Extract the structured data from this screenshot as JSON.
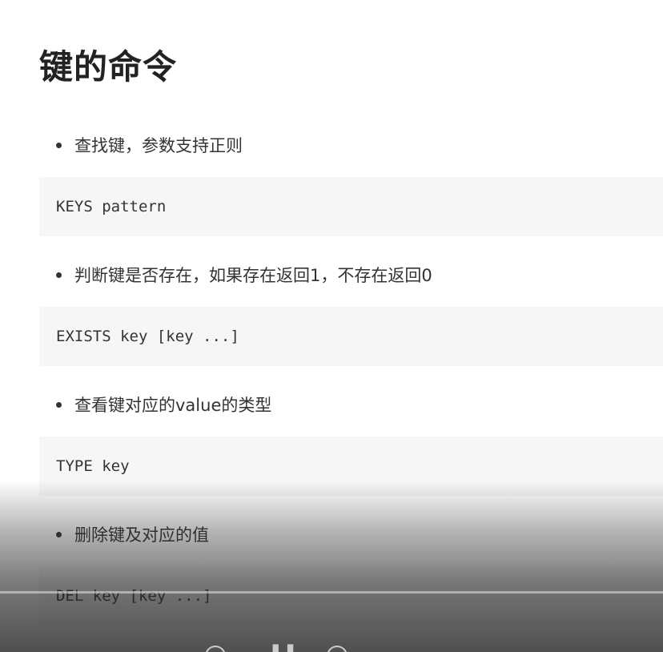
{
  "heading": "键的命令",
  "sections": [
    {
      "bullet": "查找键，参数支持正则",
      "code": "KEYS pattern"
    },
    {
      "bullet": "判断键是否存在，如果存在返回1，不存在返回0",
      "code": "EXISTS key [key ...]"
    },
    {
      "bullet": "查看键对应的value的类型",
      "code": "TYPE key"
    },
    {
      "bullet": "删除键及对应的值",
      "code": "DEL key [key ...]"
    }
  ],
  "player": {
    "icons": [
      "replay-icon",
      "pause-icon",
      "forward-icon"
    ]
  }
}
